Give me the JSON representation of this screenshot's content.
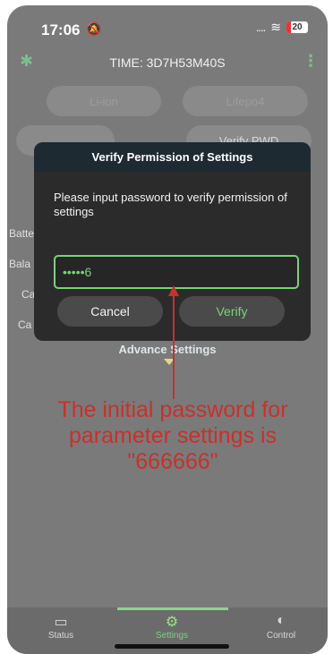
{
  "status_bar": {
    "time": "17:06",
    "dnd_icon": "bell-slash-icon",
    "signal_icon": "signal-icon",
    "wifi_icon": "wifi-icon",
    "battery_level": "20"
  },
  "app_bar": {
    "title": "TIME: 3D7H53M40S",
    "bluetooth_icon": "bluetooth-icon",
    "menu_icon": "more-vertical-icon"
  },
  "background": {
    "btn_liion": "Li-ion",
    "btn_lifepo4": "Lifepo4",
    "verify_pwd": "Verify PWD",
    "row_labels": [
      "Batte",
      "Bala",
      "Ca",
      "Ca"
    ],
    "advance_settings": "Advance Settings"
  },
  "dialog": {
    "title": "Verify Permission of Settings",
    "message": "Please input password to verify permission of settings",
    "password_value": "•••••6",
    "cancel_label": "Cancel",
    "verify_label": "Verify"
  },
  "annotation": {
    "text": "The initial password for parameter settings is \"666666\"",
    "color": "#c8312b"
  },
  "tabbar": {
    "tabs": [
      {
        "label": "Status",
        "icon": "monitor-icon"
      },
      {
        "label": "Settings",
        "icon": "gear-icon"
      },
      {
        "label": "Control",
        "icon": "toggle-icon"
      }
    ],
    "active_color": "#7ad27a"
  }
}
